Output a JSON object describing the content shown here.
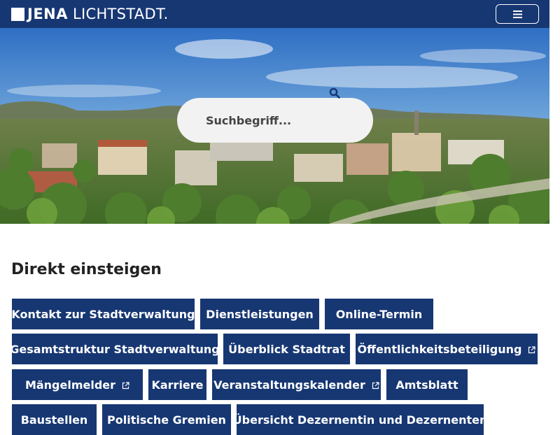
{
  "header": {
    "logo_bold": "JENA",
    "logo_light": "LICHTSTADT.",
    "menu_icon": "hamburger-icon"
  },
  "search": {
    "placeholder": "Suchbegriff...",
    "icon": "search-icon"
  },
  "quick_links": {
    "title": "Direkt einsteigen",
    "buttons": [
      {
        "label": "Kontakt zur Stadtverwaltung",
        "external": false
      },
      {
        "label": "Dienstleistungen",
        "external": false
      },
      {
        "label": "Online-Termin",
        "external": false
      },
      {
        "label": "Gesamtstruktur Stadtverwaltung",
        "external": false
      },
      {
        "label": "Überblick Stadtrat",
        "external": false
      },
      {
        "label": "Öffentlichkeitsbeteiligung",
        "external": true
      },
      {
        "label": "Mängelmelder",
        "external": true
      },
      {
        "label": "Karriere",
        "external": false
      },
      {
        "label": "Veranstaltungskalender",
        "external": true
      },
      {
        "label": "Amtsblatt",
        "external": false
      },
      {
        "label": "Baustellen",
        "external": false
      },
      {
        "label": "Politische Gremien",
        "external": false
      },
      {
        "label": "Übersicht Dezernentin und Dezernenten",
        "external": false
      }
    ]
  },
  "colors": {
    "brand": "#173773",
    "search_bg": "#f2f2f2"
  }
}
